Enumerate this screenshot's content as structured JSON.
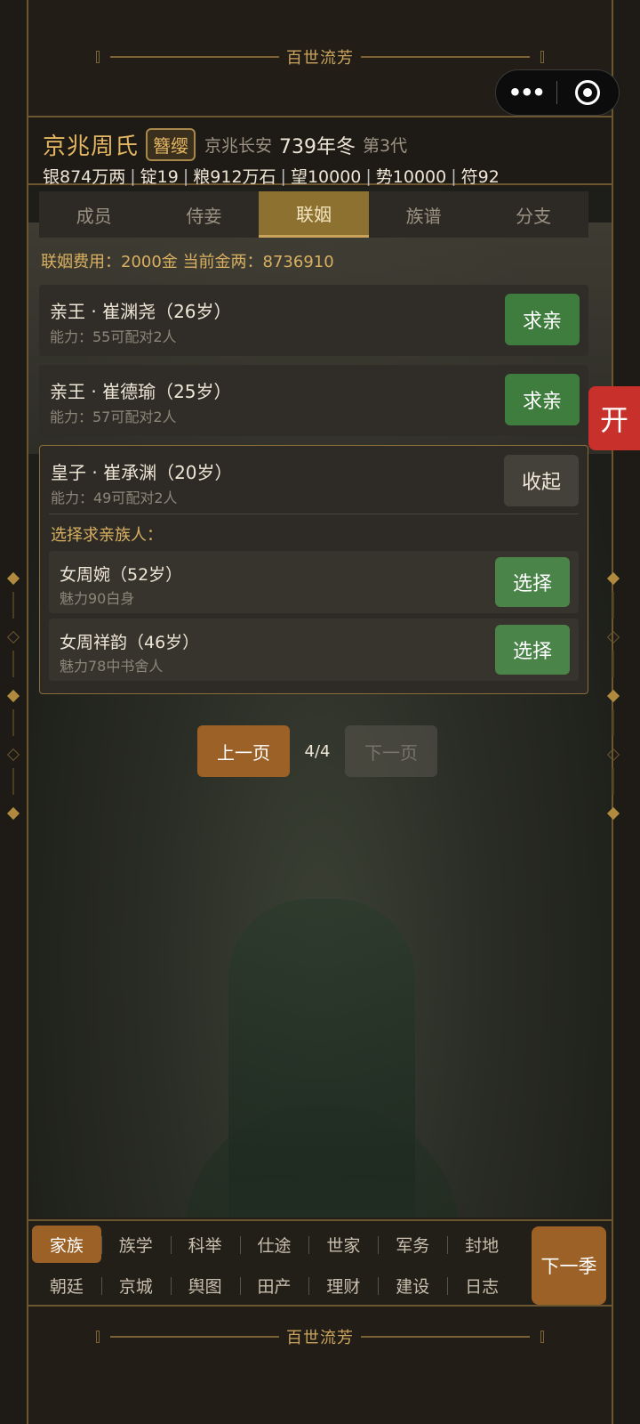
{
  "banner_top": {
    "title": "百世流芳"
  },
  "banner_bottom": {
    "title": "百世流芳"
  },
  "header": {
    "clan_name": "京兆周氏",
    "rank": "簪缨",
    "location": "京兆长安",
    "year": "739年冬",
    "generation": "第3代",
    "resources": [
      "银874万两",
      "锭19",
      "粮912万石",
      "望10000",
      "势10000",
      "符92"
    ]
  },
  "tabs": [
    {
      "label": "成员",
      "active": false
    },
    {
      "label": "侍妾",
      "active": false
    },
    {
      "label": "联姻",
      "active": true
    },
    {
      "label": "族谱",
      "active": false
    },
    {
      "label": "分支",
      "active": false
    }
  ],
  "fee_line": "联姻费用：2000金  当前金两：8736910",
  "candidates": [
    {
      "title": "亲王 · 崔渊尧（26岁）",
      "sub": "能力：55可配对2人",
      "button": "求亲"
    },
    {
      "title": "亲王 · 崔德瑜（25岁）",
      "sub": "能力：57可配对2人",
      "button": "求亲"
    },
    {
      "title": "皇子 · 崔承渊（20岁）",
      "sub": "能力：49可配对2人",
      "button": "收起"
    }
  ],
  "choose_label": "选择求亲族人：",
  "members": [
    {
      "title": "女周婉（52岁）",
      "sub": "魅力90白身",
      "button": "选择"
    },
    {
      "title": "女周祥韵（46岁）",
      "sub": "魅力78中书舍人",
      "button": "选择"
    }
  ],
  "pager": {
    "prev": "上一页",
    "page": "4/4",
    "next": "下一页"
  },
  "side_tab": "开",
  "nav_row1": [
    {
      "label": "家族",
      "active": true
    },
    {
      "label": "族学"
    },
    {
      "label": "科举"
    },
    {
      "label": "仕途"
    },
    {
      "label": "世家"
    },
    {
      "label": "军务"
    },
    {
      "label": "封地"
    }
  ],
  "nav_row2": [
    {
      "label": "朝廷"
    },
    {
      "label": "京城"
    },
    {
      "label": "舆图"
    },
    {
      "label": "田产"
    },
    {
      "label": "理财"
    },
    {
      "label": "建设"
    },
    {
      "label": "日志"
    }
  ],
  "next_season": "下一季",
  "colors": {
    "accent_gold": "#e2b663",
    "button_green": "#3f7d3e",
    "button_brown": "#9b6127",
    "side_red": "#c8302c"
  }
}
